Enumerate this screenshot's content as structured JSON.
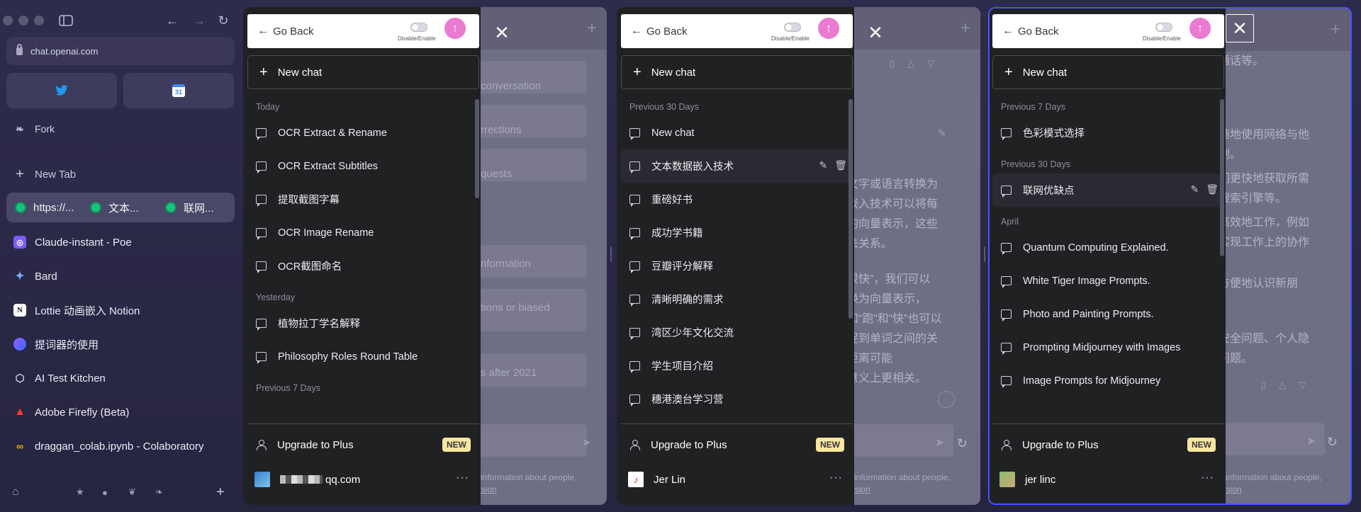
{
  "browser": {
    "url": "chat.openai.com",
    "favorites": [
      {
        "icon": "twitter-icon"
      },
      {
        "icon": "calendar-icon",
        "text": "31"
      }
    ],
    "fork_label": "Fork",
    "new_tab_label": "New Tab",
    "tab_group": [
      "https://...",
      "文本...",
      "联网..."
    ],
    "tabs": [
      {
        "label": "Claude-instant - Poe",
        "icon": "poe-icon",
        "color": "#7b5cff"
      },
      {
        "label": "Bard",
        "icon": "bard-icon",
        "color": "#4285f4"
      },
      {
        "label": "Lottie 动画嵌入 Notion",
        "icon": "notion-icon",
        "color": "#111111"
      },
      {
        "label": "提词器的使用",
        "icon": "prompt-icon",
        "color": "#3b5bff"
      },
      {
        "label": "AI Test Kitchen",
        "icon": "kitchen-icon",
        "color": "#666666"
      },
      {
        "label": "Adobe Firefly (Beta)",
        "icon": "adobe-icon",
        "color": "#e0341f"
      },
      {
        "label": "draggan_colab.ipynb - Colaboratory",
        "icon": "colab-icon",
        "color": "#f9ab00"
      }
    ]
  },
  "panels": [
    {
      "go_back": "Go Back",
      "toggle_label": "Disable/Enable",
      "new_chat": "New chat",
      "groups": [
        {
          "label": "Today",
          "items": [
            "OCR Extract & Rename",
            "OCR Extract Subtitles",
            "提取截图字幕",
            "OCR Image Rename",
            "OCR截图命名"
          ]
        },
        {
          "label": "Yesterday",
          "items": [
            "植物拉丁学名解释",
            "Philosophy Roles Round Table"
          ]
        },
        {
          "label": "Previous 7 Days",
          "items": []
        }
      ],
      "upgrade": "Upgrade to Plus",
      "badge": "NEW",
      "user": "qq.com",
      "bg_text": [
        "conversation",
        "rrections",
        "quests",
        "nformation",
        "tions or biased",
        "s after 2021",
        "e information about people,",
        "ersion"
      ]
    },
    {
      "go_back": "Go Back",
      "toggle_label": "Disable/Enable",
      "new_chat": "New chat",
      "groups": [
        {
          "label": "Previous 30 Days",
          "items": [
            "New chat",
            "文本数据嵌入技术",
            "重磅好书",
            "成功学书籍",
            "豆瓣评分解释",
            "清晰明确的需求",
            "湾区少年文化交流",
            "学生项目介绍",
            "穗港澳台学习营"
          ]
        }
      ],
      "highlighted": "文本数据嵌入技术",
      "upgrade": "Upgrade to Plus",
      "badge": "NEW",
      "user": "Jer Lin",
      "bg_text": [
        "文字或语言转换为",
        "嵌入技术可以将每",
        "的向量表示，这些",
        "法关系。",
        "很快”，我们可以",
        "换为向量表示，",
        "和“跑”和“快”也可以",
        "捉到单词之间的关",
        "距离可能",
        "意义上更相关。",
        "e information about people,",
        "ersion"
      ]
    },
    {
      "go_back": "Go Back",
      "toggle_label": "Disable/Enable",
      "new_chat": "New chat",
      "groups": [
        {
          "label": "Previous 7 Days",
          "items": [
            "色彩模式选择"
          ]
        },
        {
          "label": "Previous 30 Days",
          "items": [
            "联网优缺点"
          ]
        },
        {
          "label": "April",
          "items": [
            "Quantum Computing Explained.",
            "White Tiger Image Prompts.",
            "Photo and Painting Prompts.",
            "Prompting Midjourney with Images",
            "Image Prompts for Midjourney"
          ]
        }
      ],
      "highlighted": "联网优缺点",
      "upgrade": "Upgrade to Plus",
      "badge": "NEW",
      "user": "jer linc",
      "bg_text": [
        "通话等。",
        "随地使用网络与他",
        "制。",
        "们更快地获取所需",
        "搜索引擎等。",
        "高效地工作，例如",
        "实现工作上的协作",
        "方便地认识新朋",
        "安全问题、个人隐",
        "问题。",
        "e information about people,",
        "ersion"
      ]
    }
  ]
}
